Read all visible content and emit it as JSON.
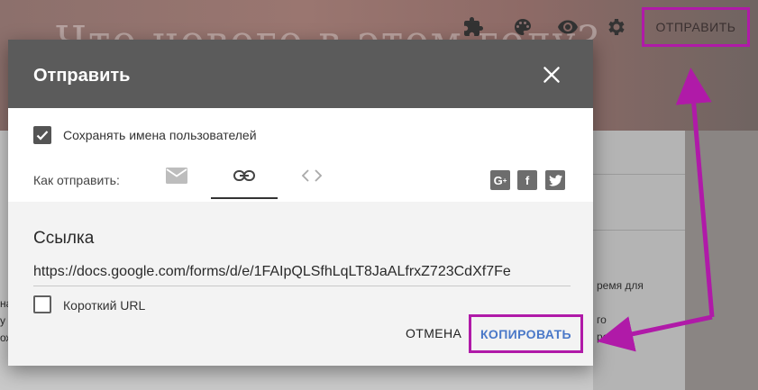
{
  "background": {
    "header_title": "Что нового в этом году?",
    "fragments": [
      "ремя для",
      "го",
      "ресн",
      "на",
      "у",
      "ож"
    ]
  },
  "toolbar": {
    "icons": [
      "puzzle-icon",
      "palette-icon",
      "eye-icon",
      "gear-icon"
    ],
    "send_label": "ОТПРАВИТЬ"
  },
  "dialog": {
    "title": "Отправить",
    "collect_emails_label": "Сохранять имена пользователей",
    "collect_emails_checked": true,
    "send_via_label": "Как отправить:",
    "methods": [
      "email-icon",
      "link-icon",
      "embed-code-icon"
    ],
    "selected_method": "link",
    "share_icons": [
      "google-plus-icon",
      "facebook-icon",
      "twitter-icon"
    ],
    "link": {
      "heading": "Ссылка",
      "url": "https://docs.google.com/forms/d/e/1FAIpQLSfhLqLT8JaALfrxZ723CdXf7Fe",
      "shorten_label": "Короткий URL",
      "shorten_checked": false
    },
    "cancel_label": "ОТМЕНА",
    "copy_label": "КОПИРОВАТЬ"
  },
  "colors": {
    "highlight": "#b01aa8",
    "accent": "#4a78c8",
    "dialog_header": "#5b5b5b"
  }
}
